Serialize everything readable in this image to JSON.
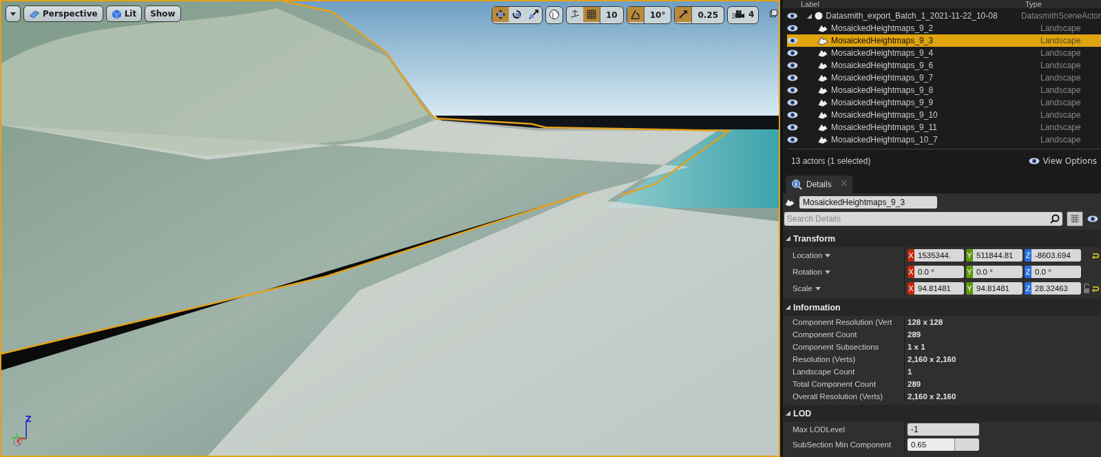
{
  "viewport": {
    "view_buttons": [
      {
        "kind": "perspective",
        "label": "Perspective"
      },
      {
        "kind": "lit",
        "label": "Lit"
      },
      {
        "kind": "plain",
        "label": "Show"
      }
    ],
    "transform_tools": [
      {
        "kind": "translate",
        "selected": true
      },
      {
        "kind": "rotate",
        "selected": false
      },
      {
        "kind": "scale",
        "selected": false
      }
    ],
    "snaps": [
      {
        "kind": "grid",
        "on": true,
        "value": "10"
      },
      {
        "kind": "angle",
        "on": true,
        "value": "10°"
      },
      {
        "kind": "scale",
        "on": true,
        "value": "0.25"
      }
    ],
    "camera_speed": "4",
    "axis_label": "Z"
  },
  "outliner": {
    "columns": [
      "Label",
      "Type"
    ],
    "rows": [
      {
        "label": "Datasmith_export_Batch_1_2021-11-22_10-08",
        "type": "DatasmithSceneActor",
        "kind": "scene",
        "selected": false,
        "expanded": true,
        "children": [
          {
            "label": "MosaickedHeightmaps_9_2",
            "type": "Landscape",
            "kind": "landscape",
            "selected": false
          },
          {
            "label": "MosaickedHeightmaps_9_3",
            "type": "Landscape",
            "kind": "landscape",
            "selected": true
          },
          {
            "label": "MosaickedHeightmaps_9_4",
            "type": "Landscape",
            "kind": "landscape",
            "selected": false
          },
          {
            "label": "MosaickedHeightmaps_9_6",
            "type": "Landscape",
            "kind": "landscape",
            "selected": false
          },
          {
            "label": "MosaickedHeightmaps_9_7",
            "type": "Landscape",
            "kind": "landscape",
            "selected": false
          },
          {
            "label": "MosaickedHeightmaps_9_8",
            "type": "Landscape",
            "kind": "landscape",
            "selected": false
          },
          {
            "label": "MosaickedHeightmaps_9_9",
            "type": "Landscape",
            "kind": "landscape",
            "selected": false
          },
          {
            "label": "MosaickedHeightmaps_9_10",
            "type": "Landscape",
            "kind": "landscape",
            "selected": false
          },
          {
            "label": "MosaickedHeightmaps_9_11",
            "type": "Landscape",
            "kind": "landscape",
            "selected": false
          },
          {
            "label": "MosaickedHeightmaps_10_7",
            "type": "Landscape",
            "kind": "landscape",
            "selected": false
          }
        ]
      }
    ],
    "status": "13 actors (1 selected)",
    "view_options": "View Options"
  },
  "details": {
    "tab": "Details",
    "actor_name": "MosaickedHeightmaps_9_3",
    "search": {
      "placeholder": "Search Details"
    },
    "sections": [
      {
        "title": "Transform",
        "expanded": true,
        "rows": [
          {
            "kind": "vector",
            "label": "Location",
            "values": [
              {
                "axis": "X",
                "value": "1535344."
              },
              {
                "axis": "Y",
                "value": "511844.81"
              },
              {
                "axis": "Z",
                "value": "-8603.694"
              }
            ],
            "reset": true,
            "lockable": false
          },
          {
            "kind": "vector",
            "label": "Rotation",
            "values": [
              {
                "axis": "X",
                "value": "0.0 °"
              },
              {
                "axis": "Y",
                "value": "0.0 °"
              },
              {
                "axis": "Z",
                "value": "0.0 °"
              }
            ],
            "reset": false,
            "lockable": false
          },
          {
            "kind": "vector",
            "label": "Scale",
            "values": [
              {
                "axis": "X",
                "value": "94.81481"
              },
              {
                "axis": "Y",
                "value": "94.81481"
              },
              {
                "axis": "Z",
                "value": "28.32463"
              }
            ],
            "reset": true,
            "lockable": true
          }
        ]
      },
      {
        "title": "Information",
        "expanded": true,
        "rows": [
          {
            "kind": "info",
            "label": "Component Resolution (Vert",
            "value": "128 x 128"
          },
          {
            "kind": "info",
            "label": "Component Count",
            "value": "289"
          },
          {
            "kind": "info",
            "label": "Component Subsections",
            "value": "1 x 1"
          },
          {
            "kind": "info",
            "label": "Resolution (Verts)",
            "value": "2,160 x 2,160"
          },
          {
            "kind": "info",
            "label": "Landscape Count",
            "value": "1"
          },
          {
            "kind": "info",
            "label": "Total Component Count",
            "value": "289"
          },
          {
            "kind": "info",
            "label": "Overall Resolution (Verts)",
            "value": "2,160 x 2,160"
          }
        ]
      },
      {
        "title": "LOD",
        "expanded": true,
        "rows": [
          {
            "kind": "number",
            "label": "Max LODLevel",
            "value": "-1"
          },
          {
            "kind": "slider",
            "label": "SubSection Min Component",
            "value": "0.65",
            "level": 0.65
          }
        ]
      }
    ]
  }
}
